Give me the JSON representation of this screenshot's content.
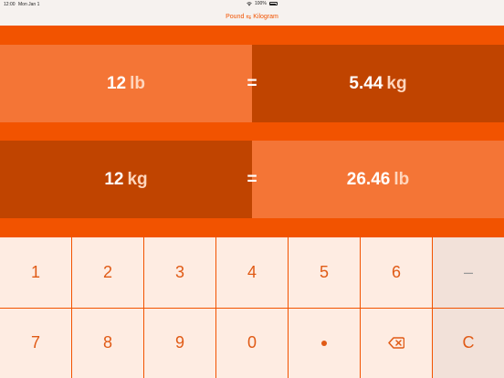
{
  "status": {
    "time": "12:00",
    "date": "Mon Jan 1",
    "battery": "100%"
  },
  "title": {
    "from": "Pound",
    "arrow": "⇆",
    "to": "Kilogram"
  },
  "conversions": [
    {
      "input_value": "12",
      "input_unit": "lb",
      "equals": "=",
      "output_value": "5.44",
      "output_unit": "kg"
    },
    {
      "input_value": "12",
      "input_unit": "kg",
      "equals": "=",
      "output_value": "26.46",
      "output_unit": "lb"
    }
  ],
  "keypad": {
    "k1": "1",
    "k2": "2",
    "k3": "3",
    "k4": "4",
    "k5": "5",
    "k6": "6",
    "minus": "–",
    "k7": "7",
    "k8": "8",
    "k9": "9",
    "k0": "0",
    "clear": "C"
  },
  "colors": {
    "accent": "#f25300",
    "light_cell": "#f47536",
    "dark_cell": "#c04400",
    "key_bg": "#feece2"
  }
}
